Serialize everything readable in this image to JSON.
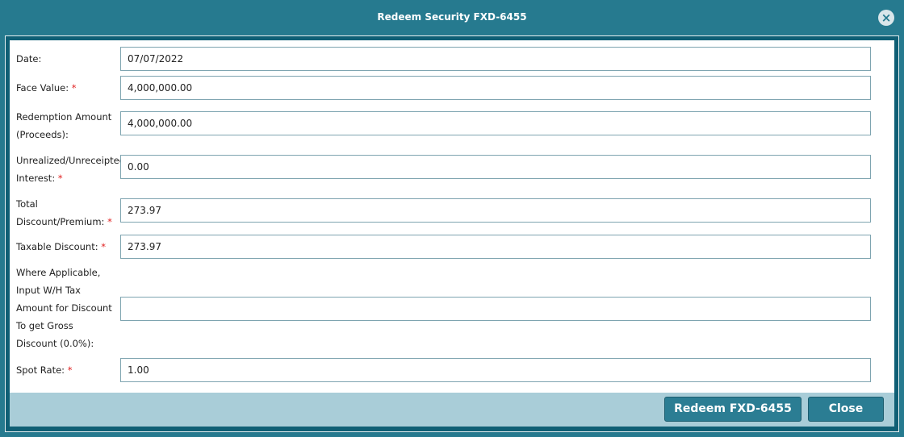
{
  "dialog": {
    "title": "Redeem Security FXD-6455",
    "close_icon": "close-circle-icon"
  },
  "fields": [
    {
      "label": "Date:",
      "required": false,
      "value": "07/07/2022"
    },
    {
      "label": "Face Value:",
      "required": true,
      "value": "4,000,000.00"
    },
    {
      "label_lines": [
        "Redemption Amount",
        "(Proceeds):"
      ],
      "required": false,
      "value": "4,000,000.00"
    },
    {
      "label_lines": [
        "Unrealized/Unreceipted",
        "Interest:"
      ],
      "required": true,
      "value": "0.00"
    },
    {
      "label_lines": [
        "Total",
        "Discount/Premium:"
      ],
      "required": true,
      "value": "273.97"
    },
    {
      "label": "Taxable Discount:",
      "required": true,
      "value": "273.97"
    },
    {
      "label_lines": [
        "Where Applicable,",
        "Input W/H Tax",
        "Amount for Discount",
        "To get Gross",
        "Discount (0.0%):"
      ],
      "required": false,
      "value": ""
    },
    {
      "label": "Spot Rate:",
      "required": true,
      "value": "1.00"
    }
  ],
  "required_marker": "*",
  "buttons": {
    "redeem": "Redeem FXD-6455",
    "close": "Close"
  }
}
